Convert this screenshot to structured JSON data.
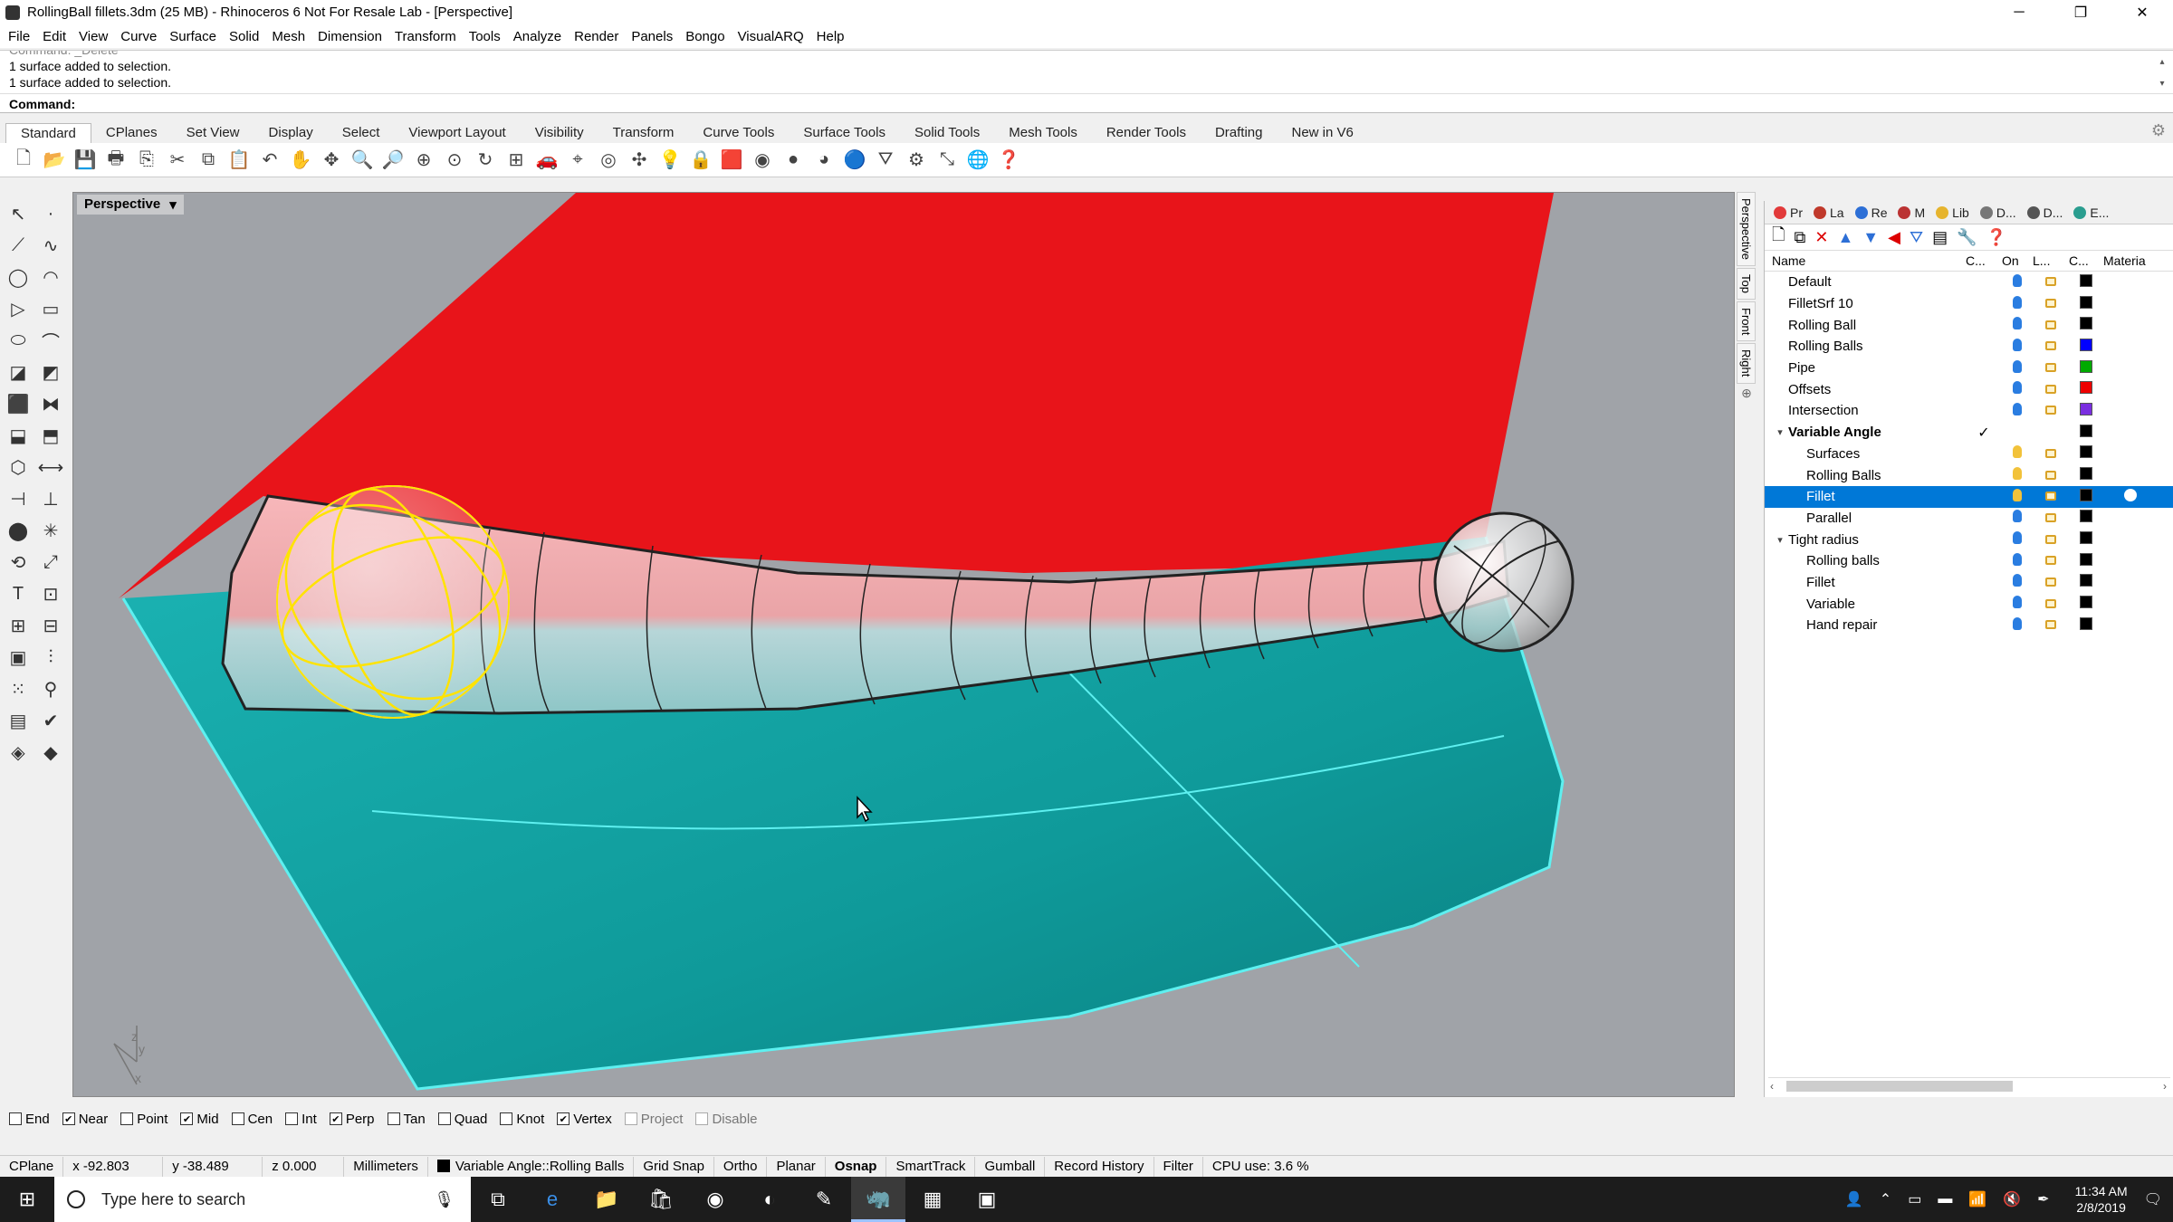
{
  "window": {
    "title": "RollingBall fillets.3dm (25 MB) - Rhinoceros 6 Not For Resale Lab - [Perspective]",
    "minimize": "─",
    "restore": "❐",
    "close": "✕"
  },
  "menu": [
    "File",
    "Edit",
    "View",
    "Curve",
    "Surface",
    "Solid",
    "Mesh",
    "Dimension",
    "Transform",
    "Tools",
    "Analyze",
    "Render",
    "Panels",
    "Bongo",
    "VisualARQ",
    "Help"
  ],
  "command": {
    "history": [
      "Command: _Delete",
      "1 surface added to selection.",
      "1 surface added to selection."
    ],
    "prompt": "Command:"
  },
  "toolbar_tabs": [
    "Standard",
    "CPlanes",
    "Set View",
    "Display",
    "Select",
    "Viewport Layout",
    "Visibility",
    "Transform",
    "Curve Tools",
    "Surface Tools",
    "Solid Tools",
    "Mesh Tools",
    "Render Tools",
    "Drafting",
    "New in V6"
  ],
  "active_tab": "Standard",
  "viewport": {
    "name": "Perspective",
    "dropdown": "▾",
    "axis_y": "y",
    "axis_z": "z",
    "axis_x": "x"
  },
  "side_tabs": [
    "Perspective",
    "Top",
    "Front",
    "Right"
  ],
  "panel": {
    "tabs": [
      {
        "label": "Pr",
        "color": "#e23a3a"
      },
      {
        "label": "La",
        "color": "#c0392b"
      },
      {
        "label": "Re",
        "color": "#2d6fd6"
      },
      {
        "label": "M",
        "color": "#b33"
      },
      {
        "label": "Lib",
        "color": "#e6b42e"
      },
      {
        "label": "D...",
        "color": "#777"
      },
      {
        "label": "D...",
        "color": "#555"
      },
      {
        "label": "E...",
        "color": "#2a9d8f"
      }
    ],
    "columns": {
      "name": "Name",
      "current": "C...",
      "on": "On",
      "lock": "L...",
      "color": "C...",
      "material": "Materia"
    },
    "layers": [
      {
        "name": "Default",
        "indent": 1,
        "color": "#000000",
        "on": true,
        "expander": "",
        "current": "",
        "selected": false
      },
      {
        "name": "FilletSrf 10",
        "indent": 1,
        "color": "#000000",
        "on": true,
        "expander": "",
        "current": "",
        "selected": false
      },
      {
        "name": "Rolling Ball",
        "indent": 1,
        "color": "#000000",
        "on": true,
        "expander": "",
        "current": "",
        "selected": false
      },
      {
        "name": "Rolling Balls",
        "indent": 1,
        "color": "#0000ff",
        "on": true,
        "expander": "",
        "current": "",
        "selected": false
      },
      {
        "name": "Pipe",
        "indent": 1,
        "color": "#00aa00",
        "on": true,
        "expander": "",
        "current": "",
        "selected": false
      },
      {
        "name": "Offsets",
        "indent": 1,
        "color": "#ee0000",
        "on": true,
        "expander": "",
        "current": "",
        "selected": false
      },
      {
        "name": "Intersection",
        "indent": 1,
        "color": "#7a2ee0",
        "on": true,
        "expander": "",
        "current": "",
        "selected": false
      },
      {
        "name": "Variable Angle",
        "indent": 0,
        "color": "#000000",
        "on": null,
        "expander": "▾",
        "current": "✓",
        "selected": false,
        "bold": true
      },
      {
        "name": "Surfaces",
        "indent": 2,
        "color": "#000000",
        "on": false,
        "expander": "",
        "current": "",
        "selected": false
      },
      {
        "name": "Rolling Balls",
        "indent": 2,
        "color": "#000000",
        "on": false,
        "expander": "",
        "current": "",
        "selected": false
      },
      {
        "name": "Fillet",
        "indent": 2,
        "color": "#000000",
        "on": false,
        "expander": "",
        "current": "",
        "selected": true
      },
      {
        "name": "Parallel",
        "indent": 2,
        "color": "#000000",
        "on": true,
        "expander": "",
        "current": "",
        "selected": false
      },
      {
        "name": "Tight radius",
        "indent": 0,
        "color": "#000000",
        "on": true,
        "expander": "▾",
        "current": "",
        "selected": false
      },
      {
        "name": "Rolling balls",
        "indent": 2,
        "color": "#000000",
        "on": true,
        "expander": "",
        "current": "",
        "selected": false
      },
      {
        "name": "Fillet",
        "indent": 2,
        "color": "#000000",
        "on": true,
        "expander": "",
        "current": "",
        "selected": false
      },
      {
        "name": "Variable",
        "indent": 2,
        "color": "#000000",
        "on": true,
        "expander": "",
        "current": "",
        "selected": false
      },
      {
        "name": "Hand repair",
        "indent": 2,
        "color": "#000000",
        "on": true,
        "expander": "",
        "current": "",
        "selected": false
      }
    ],
    "scroll_left": "‹",
    "scroll_right": "›"
  },
  "osnaps": [
    {
      "label": "End",
      "checked": false,
      "disabled": false
    },
    {
      "label": "Near",
      "checked": true,
      "disabled": false
    },
    {
      "label": "Point",
      "checked": false,
      "disabled": false
    },
    {
      "label": "Mid",
      "checked": true,
      "disabled": false
    },
    {
      "label": "Cen",
      "checked": false,
      "disabled": false
    },
    {
      "label": "Int",
      "checked": false,
      "disabled": false
    },
    {
      "label": "Perp",
      "checked": true,
      "disabled": false
    },
    {
      "label": "Tan",
      "checked": false,
      "disabled": false
    },
    {
      "label": "Quad",
      "checked": false,
      "disabled": false
    },
    {
      "label": "Knot",
      "checked": false,
      "disabled": false
    },
    {
      "label": "Vertex",
      "checked": true,
      "disabled": false
    },
    {
      "label": "Project",
      "checked": false,
      "disabled": true
    },
    {
      "label": "Disable",
      "checked": false,
      "disabled": true
    }
  ],
  "status": {
    "cplane": "CPlane",
    "x": "x -92.803",
    "y": "y -38.489",
    "z": "z 0.000",
    "units": "Millimeters",
    "layer": "Variable Angle::Rolling Balls",
    "grid_snap": "Grid Snap",
    "ortho": "Ortho",
    "planar": "Planar",
    "osnap": "Osnap",
    "smarttrack": "SmartTrack",
    "gumball": "Gumball",
    "record_history": "Record History",
    "filter": "Filter",
    "cpu": "CPU use: 3.6 %"
  },
  "taskbar": {
    "search_placeholder": "Type here to search",
    "time": "11:34 AM",
    "date": "2/8/2019"
  },
  "colors": {
    "red_surface": "#e8141a",
    "teal_surface": "#12a3a3",
    "fillet_pink": "#efa8aa",
    "selection_blue": "#0078d7",
    "viewport_bg": "#a0a3a8"
  }
}
